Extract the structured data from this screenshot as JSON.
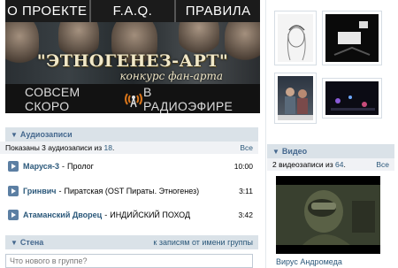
{
  "banner": {
    "nav": [
      "О ПРОЕКТЕ",
      "F.A.Q.",
      "ПРАВИЛА"
    ],
    "title": "\"ЭТНОГЕНЕЗ-АРТ\"",
    "subtitle": "конкурс фан-арта",
    "bottom_left": "СОВСЕМ СКОРО",
    "bottom_right": "В РАДИОЭФИРЕ"
  },
  "audio": {
    "title": "Аудиозаписи",
    "summary_prefix": "Показаны 3 аудиозаписи из ",
    "summary_count": "18",
    "summary_suffix": ".",
    "all_link": "Все",
    "tracks": [
      {
        "artist": "Маруся-3",
        "sep": "-",
        "song": "Пролог",
        "duration": "10:00"
      },
      {
        "artist": "Гринвич",
        "sep": "-",
        "song": "Пиратская (OST Пираты. Этногенез)",
        "duration": "3:11"
      },
      {
        "artist": "Атаманский Дворец",
        "sep": "-",
        "song": "ИНДИЙСКИЙ ПОХОД",
        "duration": "3:42"
      }
    ]
  },
  "wall": {
    "title": "Стена",
    "right_link": "к записям от имени группы",
    "placeholder": "Что нового в группе?"
  },
  "video": {
    "title": "Видео",
    "summary_prefix": "2 видеозаписи из ",
    "summary_count": "64",
    "summary_suffix": ".",
    "all_link": "Все",
    "caption": "Вирус Андромеда"
  },
  "colors": {
    "header_bg": "#dae2e8",
    "link": "#2b587a",
    "header_text": "#45688e"
  }
}
